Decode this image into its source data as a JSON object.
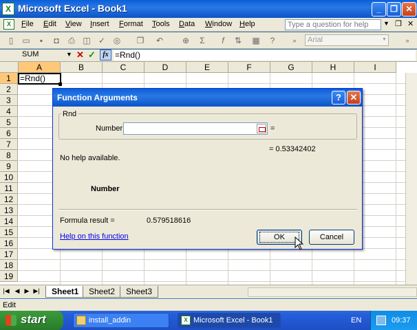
{
  "window": {
    "title": "Microsoft Excel - Book1",
    "minimize_glyph": "_",
    "restore_glyph": "❐",
    "close_glyph": "✕"
  },
  "menubar": {
    "items": [
      "File",
      "Edit",
      "View",
      "Insert",
      "Format",
      "Tools",
      "Data",
      "Window",
      "Help"
    ],
    "ask_placeholder": "Type a question for help",
    "restore_glyph": "❐",
    "close_glyph": "✕"
  },
  "toolbar": {
    "font_name": "Arial",
    "icons": [
      "new-icon",
      "open-icon",
      "save-icon",
      "permission-icon",
      "print-icon",
      "copy-icon",
      "undo-icon",
      "hyperlink-icon",
      "autosum-icon",
      "insert-function-icon",
      "sort-ascending-icon",
      "help-icon"
    ]
  },
  "formula_bar": {
    "name_box": "SUM",
    "cancel_glyph": "✕",
    "enter_glyph": "✓",
    "fx_label": "fx",
    "formula": "=Rnd()"
  },
  "grid": {
    "columns": [
      "A",
      "B",
      "C",
      "D",
      "E",
      "F",
      "G",
      "H",
      "I"
    ],
    "rows": [
      "1",
      "2",
      "3",
      "4",
      "5",
      "6",
      "7",
      "8",
      "9",
      "10",
      "11",
      "12",
      "13",
      "14",
      "15",
      "16",
      "17",
      "18",
      "19"
    ],
    "selected_col": "A",
    "selected_row": "1",
    "active_cell_text": "=Rnd()"
  },
  "sheets": {
    "tabs": [
      "Sheet1",
      "Sheet2",
      "Sheet3"
    ],
    "active": "Sheet1"
  },
  "status": {
    "text": "Edit"
  },
  "taskbar": {
    "start_label": "start",
    "items": [
      "install_addin",
      "Microsoft Excel - Book1"
    ],
    "language": "EN",
    "clock": "09:37"
  },
  "dialog": {
    "title": "Function Arguments",
    "help_glyph": "?",
    "close_glyph": "✕",
    "function_name": "Rnd",
    "argument_label": "Number",
    "argument_value": "",
    "equals": "=",
    "argument_result": "= 0.53342402",
    "help_text": "No help available.",
    "argument_description_name": "Number",
    "formula_result_label": "Formula result =",
    "formula_result_value": "0.579518616",
    "help_link": "Help on this function",
    "ok_label": "OK",
    "cancel_label": "Cancel"
  }
}
